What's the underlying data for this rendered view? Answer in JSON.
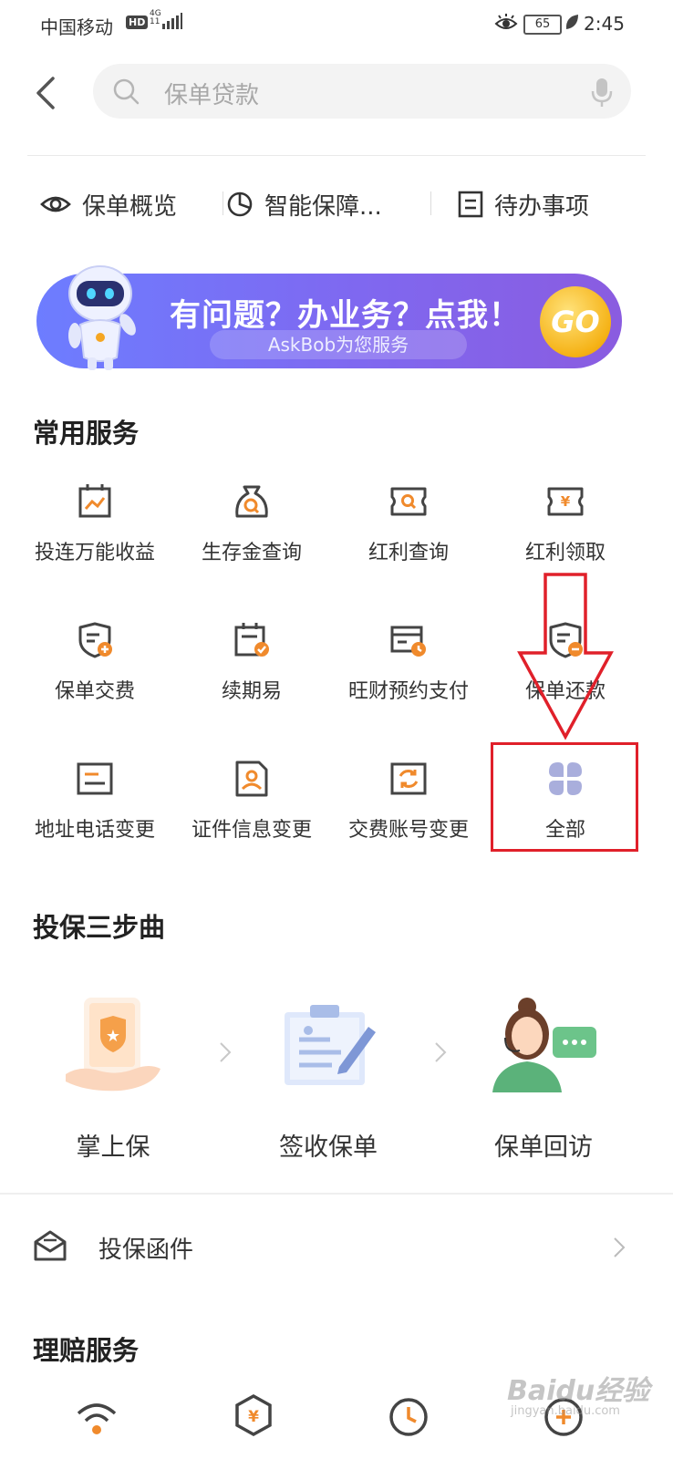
{
  "status_bar": {
    "carrier": "中国移动",
    "hd": "HD",
    "network_top": "4G",
    "network_bottom": "11",
    "battery": "65",
    "time": "2:45"
  },
  "search": {
    "placeholder": "保单贷款"
  },
  "quick_tabs": [
    {
      "label": "保单概览",
      "icon": "eye-icon"
    },
    {
      "label": "智能保障...",
      "icon": "pie-chart-icon"
    },
    {
      "label": "待办事项",
      "icon": "todo-list-icon"
    }
  ],
  "banner": {
    "title": "有问题？办业务？点我！",
    "subtitle": "AskBob为您服务",
    "go_label": "GO"
  },
  "sections": {
    "common_services": "常用服务",
    "three_steps": "投保三步曲",
    "claims": "理赔服务"
  },
  "services": [
    {
      "label": "投连万能收益",
      "icon": "calendar-trend-icon"
    },
    {
      "label": "生存金查询",
      "icon": "money-bag-search-icon"
    },
    {
      "label": "红利查询",
      "icon": "ticket-search-icon"
    },
    {
      "label": "红利领取",
      "icon": "ticket-yen-icon"
    },
    {
      "label": "保单交费",
      "icon": "shield-plus-icon"
    },
    {
      "label": "续期易",
      "icon": "calendar-check-icon"
    },
    {
      "label": "旺财预约支付",
      "icon": "card-clock-icon"
    },
    {
      "label": "保单还款",
      "icon": "shield-minus-icon"
    },
    {
      "label": "地址电话变更",
      "icon": "address-card-icon"
    },
    {
      "label": "证件信息变更",
      "icon": "id-card-icon"
    },
    {
      "label": "交费账号变更",
      "icon": "account-refresh-icon"
    },
    {
      "label": "全部",
      "icon": "four-petal-grid-icon"
    }
  ],
  "steps": [
    {
      "label": "掌上保",
      "icon": "hand-shield-phone-icon"
    },
    {
      "label": "签收保单",
      "icon": "clipboard-pen-icon"
    },
    {
      "label": "保单回访",
      "icon": "customer-service-agent-icon"
    }
  ],
  "insure_letter": {
    "label": "投保函件",
    "icon": "envelope-icon"
  },
  "claim_icons": [
    "wifi-alert-icon",
    "hexagon-yen-icon",
    "clock-icon",
    "plus-circle-icon"
  ],
  "watermark": {
    "brand": "Baidu经验",
    "url": "jingyan.baidu.com"
  },
  "colors": {
    "accent_orange": "#f08a2c",
    "banner_start": "#6d7dff",
    "banner_end": "#8a5ce0",
    "annotation_red": "#e0202a",
    "all_icon_lavender": "#a9aedc"
  }
}
